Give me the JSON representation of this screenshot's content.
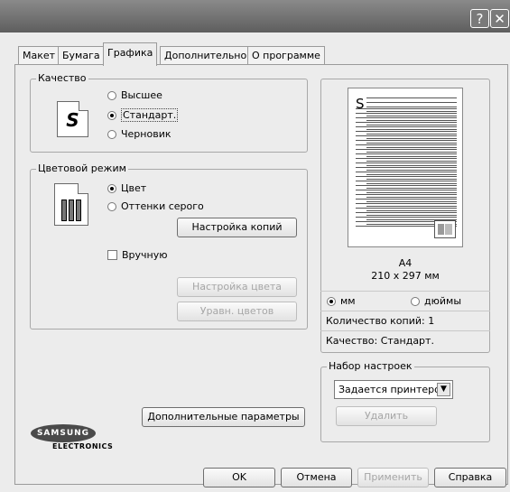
{
  "titlebar": {
    "help_glyph": "?",
    "close_glyph": "✕"
  },
  "tabs": [
    {
      "label": "Макет"
    },
    {
      "label": "Бумага"
    },
    {
      "label": "Графика"
    },
    {
      "label": "Дополнительно"
    },
    {
      "label": "О программе"
    }
  ],
  "quality": {
    "title": "Качество",
    "icon_letter": "S",
    "options": [
      "Высшее",
      "Стандарт.",
      "Черновик"
    ],
    "selected": "Стандарт."
  },
  "color_mode": {
    "title": "Цветовой режим",
    "options": [
      "Цвет",
      "Оттенки серого"
    ],
    "selected": "Цвет",
    "copy_settings_button": "Настройка копий",
    "manual_label": "Вручную",
    "color_settings_button": "Настройка цвета",
    "color_match_button": "Уравн. цветов"
  },
  "preview": {
    "letter": "S",
    "paper": "A4",
    "dims": "210 x 297 мм",
    "unit_mm": "мм",
    "unit_inch": "дюймы",
    "selected_unit": "мм",
    "copies": "Количество копий: 1",
    "quality": "Качество: Стандарт."
  },
  "presets": {
    "title": "Набор настроек",
    "selected": "Задается принтером",
    "delete_button": "Удалить"
  },
  "advanced_button": "Дополнительные параметры",
  "logo": {
    "brand": "SAMSUNG",
    "sub": "ELECTRONICS"
  },
  "footer": {
    "ok": "OK",
    "cancel": "Отмена",
    "apply": "Применить",
    "help": "Справка"
  }
}
